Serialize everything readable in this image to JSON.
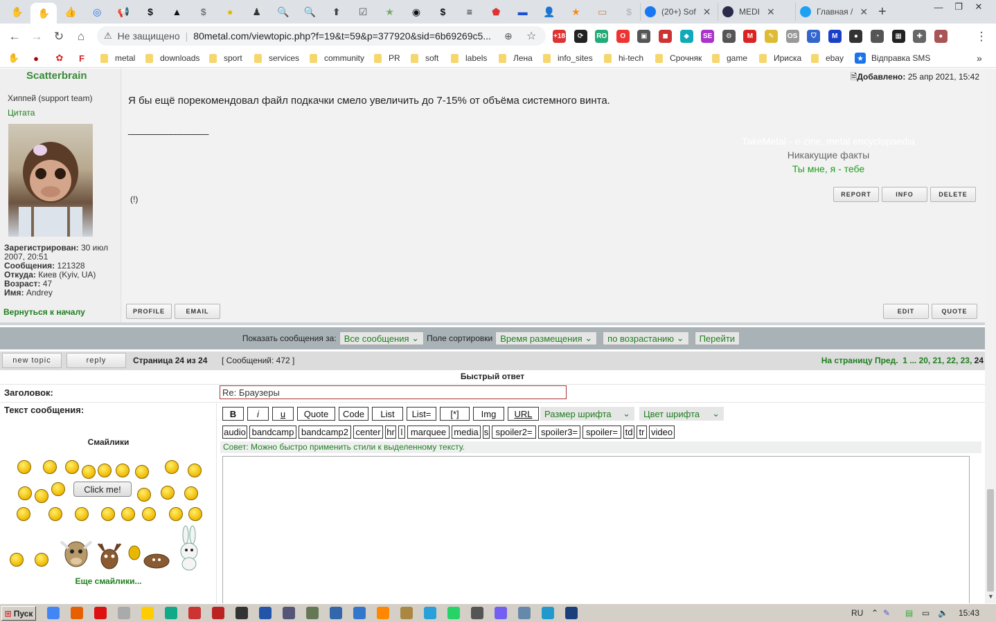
{
  "browser": {
    "tabs_pinned": [
      {
        "name": "hand-icon",
        "glyph": "✋",
        "color": "#444"
      },
      {
        "name": "hand-icon",
        "glyph": "✋",
        "color": "#444",
        "active": true
      },
      {
        "name": "thumbs-up-icon",
        "glyph": "👍",
        "color": "#3b5998"
      },
      {
        "name": "target-icon",
        "glyph": "◎",
        "color": "#1a73e8"
      },
      {
        "name": "megaphone-icon",
        "glyph": "📢",
        "color": "#333"
      },
      {
        "name": "dollar-icon",
        "glyph": "$",
        "color": "#111"
      },
      {
        "name": "bird-icon",
        "glyph": "▲",
        "color": "#111"
      },
      {
        "name": "dollar-circle-icon",
        "glyph": "$",
        "color": "#777"
      },
      {
        "name": "coin-icon",
        "glyph": "●",
        "color": "#e6b800"
      },
      {
        "name": "figure-icon",
        "glyph": "♟",
        "color": "#333"
      },
      {
        "name": "search-icon",
        "glyph": "🔍",
        "color": "#888"
      },
      {
        "name": "search-icon",
        "glyph": "🔍",
        "color": "#888"
      },
      {
        "name": "upload-icon",
        "glyph": "⬆",
        "color": "#444"
      },
      {
        "name": "checkbox-icon",
        "glyph": "☑",
        "color": "#555"
      },
      {
        "name": "award-icon",
        "glyph": "★",
        "color": "#7a6"
      },
      {
        "name": "eye-icon",
        "glyph": "◉",
        "color": "#111"
      },
      {
        "name": "dollar-icon",
        "glyph": "$",
        "color": "#111"
      },
      {
        "name": "menu-icon",
        "glyph": "≡",
        "color": "#222"
      },
      {
        "name": "pentagon-icon",
        "glyph": "⬟",
        "color": "#d33"
      },
      {
        "name": "flag-icon",
        "glyph": "▬",
        "color": "#1a4fd6"
      },
      {
        "name": "person-icon",
        "glyph": "👤",
        "color": "#333"
      },
      {
        "name": "star-icon",
        "glyph": "★",
        "color": "#f80"
      },
      {
        "name": "wallet-icon",
        "glyph": "▭",
        "color": "#b85"
      },
      {
        "name": "dollar-icon",
        "glyph": "$",
        "color": "#bbb"
      }
    ],
    "tabs_labeled": [
      {
        "label": "(20+) Sof",
        "icon_color": "#1877f2"
      },
      {
        "label": "MEDI",
        "icon_color": "#2a2a4a"
      },
      {
        "label": "Главная /",
        "icon_color": "#1da1f2"
      }
    ],
    "new_tab": "+",
    "address": {
      "security": "Не защищено",
      "url": "80metal.com/viewtopic.php?f=19&t=59&p=377920&sid=6b69269c5..."
    },
    "extensions": [
      {
        "name": "adult-ext-icon",
        "text": "+18",
        "color": "#d33"
      },
      {
        "name": "refresh-ext-icon",
        "text": "⟳",
        "color": "#222"
      },
      {
        "name": "ro-ext-icon",
        "text": "RO",
        "color": "#2a7"
      },
      {
        "name": "opera-ext-icon",
        "text": "O",
        "color": "#e33"
      },
      {
        "name": "cube-ext-icon",
        "text": "▣",
        "color": "#555"
      },
      {
        "name": "camera-ext-icon",
        "text": "◼",
        "color": "#c33"
      },
      {
        "name": "diamond-ext-icon",
        "text": "◆",
        "color": "#1ab"
      },
      {
        "name": "se-ext-icon",
        "text": "SE",
        "color": "#a3c"
      },
      {
        "name": "wheel-ext-icon",
        "text": "⚙",
        "color": "#555"
      },
      {
        "name": "mega-ext-icon",
        "text": "M",
        "color": "#d22"
      },
      {
        "name": "pen-ext-icon",
        "text": "✎",
        "color": "#db3"
      },
      {
        "name": "os-ext-icon",
        "text": "OS",
        "color": "#999"
      },
      {
        "name": "shield-ext-icon",
        "text": "⛉",
        "color": "#36c"
      },
      {
        "name": "m-ext-icon",
        "text": "M",
        "color": "#1a3fc8"
      },
      {
        "name": "dots-ext-icon",
        "text": "●",
        "color": "#333"
      },
      {
        "name": "clock-ext-icon",
        "text": "◔",
        "color": "#555"
      },
      {
        "name": "grid-ext-icon",
        "text": "▦",
        "color": "#222"
      },
      {
        "name": "puzzle-icon",
        "text": "✚",
        "color": "#666"
      },
      {
        "name": "profile-avatar",
        "text": "●",
        "color": "#a55"
      }
    ],
    "bookmarks": [
      "metal",
      "downloads",
      "sport",
      "services",
      "community",
      "PR",
      "soft",
      "labels",
      "Лена",
      "info_sites",
      "hi-tech",
      "Срочняк",
      "game",
      "Ириска",
      "ebay"
    ],
    "bookmark_sms": "Відправка SMS",
    "bookmarks_overflow": "»"
  },
  "post": {
    "author": "Scatterbrain",
    "rank": "Хиппей (support team)",
    "quote_link": "Цитата",
    "registered_label": "Зарегистрирован:",
    "registered_value": "30 июл",
    "registered_value2": "2007, 20:51",
    "posts_label": "Сообщения:",
    "posts_value": "121328",
    "from_label": "Откуда:",
    "from_value": "Киев (Kyiv, UA)",
    "age_label": "Возраст:",
    "age_value": "47",
    "name_label": "Имя:",
    "name_value": "Andrey",
    "added_label": "Добавлено:",
    "added_value": "25 апр 2021, 15:42",
    "message": "Я бы ещё порекомендовал файл подкачки смело увеличить до 7-15% от объёма системного винта.",
    "sig_line": "_________________",
    "sig1": "TakeMetal - e-zine, metal encyclopaedia",
    "sig2": "Никакущие факты",
    "sig3": "Ты мне, я - тебе",
    "mark": "(!)",
    "btn_report": "REPORT",
    "btn_info": "INFO",
    "btn_delete": "DELETE",
    "back_to_top": "Вернуться к началу",
    "btn_profile": "PROFILE",
    "btn_email": "EMAIL",
    "btn_edit": "EDIT",
    "btn_quote": "QUOTE"
  },
  "sort": {
    "show_label": "Показать сообщения за:",
    "show_value": "Все сообщения",
    "sort_label": "Поле сортировки",
    "sort_value": "Время размещения",
    "order_value": "по возрастанию",
    "go": "Перейти"
  },
  "pagination": {
    "new_topic": "new topic",
    "reply": "reply",
    "page_info": "Страница 24 из 24",
    "count_info": "[ Сообщений: 472 ]",
    "nav_label": "На страницу Пред.",
    "pages": [
      "1",
      "...",
      "20,",
      "21,",
      "22,",
      "23,",
      "24"
    ]
  },
  "quick_reply": {
    "header": "Быстрый ответ",
    "subject_label": "Заголовок:",
    "subject_value": "Re: Браузеры",
    "text_label": "Текст сообщения:",
    "smilies_title": "Смайлики",
    "click_me": "Click me!",
    "more_smilies": "Еще смайлики...",
    "buttons_row1": [
      {
        "label": "B",
        "w": 31
      },
      {
        "label": "i",
        "w": 31
      },
      {
        "label": "u",
        "w": 31
      },
      {
        "label": "Quote",
        "w": 55
      },
      {
        "label": "Code",
        "w": 43
      },
      {
        "label": "List",
        "w": 45
      },
      {
        "label": "List=",
        "w": 43
      },
      {
        "label": "[*]",
        "w": 43
      },
      {
        "label": "Img",
        "w": 45
      },
      {
        "label": "URL",
        "w": 45
      }
    ],
    "font_size": "Размер шрифта",
    "font_color": "Цвет шрифта",
    "buttons_row2": [
      "audio",
      "bandcamp",
      "bandcamp2",
      "center",
      "hr",
      "l",
      "marquee",
      "media",
      "s",
      "spoiler2=",
      "spoiler3=",
      "spoiler=",
      "td",
      "tr",
      "video"
    ],
    "tip": "Совет: Можно быстро применить стили к выделенному тексту."
  },
  "taskbar": {
    "start": "Пуск",
    "apps": [
      {
        "name": "chrome-icon",
        "color": "#4285f4"
      },
      {
        "name": "firefox-icon",
        "color": "#e66000"
      },
      {
        "name": "opera-icon",
        "color": "#d11"
      },
      {
        "name": "app-icon",
        "color": "#aaa"
      },
      {
        "name": "norton-icon",
        "color": "#fc0"
      },
      {
        "name": "pycharm-icon",
        "color": "#1a8"
      },
      {
        "name": "app-icon",
        "color": "#c33"
      },
      {
        "name": "filezilla-icon",
        "color": "#b22"
      },
      {
        "name": "app-icon",
        "color": "#333"
      },
      {
        "name": "ip-icon",
        "color": "#2255aa"
      },
      {
        "name": "network-icon",
        "color": "#557"
      },
      {
        "name": "app-icon",
        "color": "#675"
      },
      {
        "name": "save-icon",
        "color": "#36a"
      },
      {
        "name": "app-icon",
        "color": "#37c"
      },
      {
        "name": "vlc-icon",
        "color": "#f80"
      },
      {
        "name": "app-icon",
        "color": "#a84"
      },
      {
        "name": "telegram-icon",
        "color": "#29a0da"
      },
      {
        "name": "whatsapp-icon",
        "color": "#25d366"
      },
      {
        "name": "app-icon",
        "color": "#555"
      },
      {
        "name": "viber-icon",
        "color": "#7360f2"
      },
      {
        "name": "app-icon",
        "color": "#68a"
      },
      {
        "name": "shield-icon",
        "color": "#29c"
      },
      {
        "name": "ip-icon",
        "color": "#1a3f7a"
      }
    ],
    "lang": "RU",
    "clock": "15:43"
  }
}
